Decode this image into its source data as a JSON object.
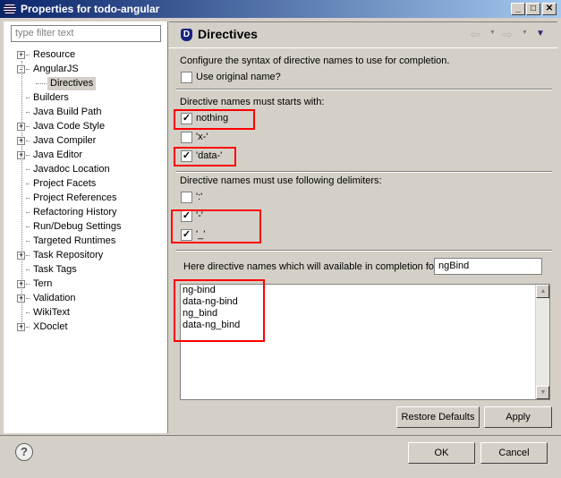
{
  "window": {
    "title": "Properties for todo-angular",
    "minimize": "_",
    "maximize": "□",
    "close": "✕"
  },
  "sidebar": {
    "filter_placeholder": "type filter text",
    "items": [
      {
        "label": "Resource",
        "expander": "+",
        "level": 0
      },
      {
        "label": "AngularJS",
        "expander": "-",
        "level": 0
      },
      {
        "label": "Directives",
        "level": 1,
        "selected": true
      },
      {
        "label": "Builders",
        "level": 0
      },
      {
        "label": "Java Build Path",
        "level": 0
      },
      {
        "label": "Java Code Style",
        "expander": "+",
        "level": 0
      },
      {
        "label": "Java Compiler",
        "expander": "+",
        "level": 0
      },
      {
        "label": "Java Editor",
        "expander": "+",
        "level": 0
      },
      {
        "label": "Javadoc Location",
        "level": 0
      },
      {
        "label": "Project Facets",
        "level": 0
      },
      {
        "label": "Project References",
        "level": 0
      },
      {
        "label": "Refactoring History",
        "level": 0
      },
      {
        "label": "Run/Debug Settings",
        "level": 0
      },
      {
        "label": "Targeted Runtimes",
        "level": 0
      },
      {
        "label": "Task Repository",
        "expander": "+",
        "level": 0
      },
      {
        "label": "Task Tags",
        "level": 0
      },
      {
        "label": "Tern",
        "expander": "+",
        "level": 0
      },
      {
        "label": "Validation",
        "expander": "+",
        "level": 0
      },
      {
        "label": "WikiText",
        "level": 0
      },
      {
        "label": "XDoclet",
        "expander": "+",
        "level": 0
      }
    ]
  },
  "page": {
    "title": "Directives",
    "icon_letter": "D",
    "description": "Configure the syntax of directive names to use for completion.",
    "use_original": {
      "label": "Use original name?",
      "checked": false
    },
    "starts_label": "Directive names must starts with:",
    "starts": [
      {
        "label": "nothing",
        "checked": true
      },
      {
        "label": "'x-'",
        "checked": false
      },
      {
        "label": "'data-'",
        "checked": true
      }
    ],
    "delims_label": "Directive names must use following delimiters:",
    "delims": [
      {
        "label": "':'",
        "checked": false
      },
      {
        "label": "'-'",
        "checked": true
      },
      {
        "label": "'_'",
        "checked": true
      }
    ],
    "completion_label": "Here directive names which will available in completion for",
    "completion_value": "ngBind",
    "results": [
      "ng-bind",
      "data-ng-bind",
      "ng_bind",
      "data-ng_bind"
    ],
    "restore_defaults": "Restore Defaults",
    "apply": "Apply"
  },
  "footer": {
    "help": "?",
    "ok": "OK",
    "cancel": "Cancel"
  },
  "colors": {
    "highlight": "#ff0000",
    "title_start": "#0a246a",
    "title_end": "#a6caf0"
  }
}
